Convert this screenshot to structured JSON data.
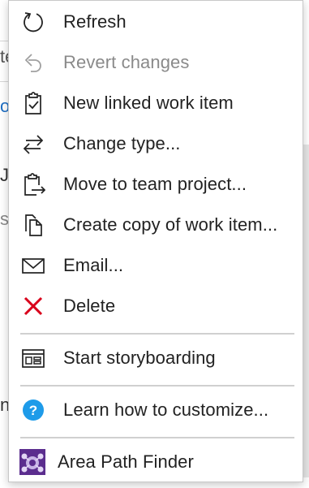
{
  "menu": {
    "items": [
      {
        "label": "Refresh",
        "icon": "refresh-icon"
      },
      {
        "label": "Revert changes",
        "icon": "undo-icon"
      },
      {
        "label": "New linked work item",
        "icon": "clipboard-check-icon"
      },
      {
        "label": "Change type...",
        "icon": "swap-arrows-icon"
      },
      {
        "label": "Move to team project...",
        "icon": "clipboard-arrow-icon"
      },
      {
        "label": "Create copy of work item...",
        "icon": "copy-icon"
      },
      {
        "label": "Email...",
        "icon": "envelope-icon"
      },
      {
        "label": "Delete",
        "icon": "delete-x-icon"
      },
      {
        "label": "Start storyboarding",
        "icon": "storyboard-icon"
      },
      {
        "label": "Learn how to customize...",
        "icon": "help-icon"
      },
      {
        "label": "Area Path Finder",
        "icon": "extension-logo-icon"
      }
    ]
  },
  "background": {
    "fragments": [
      "te",
      "o",
      "J",
      "s",
      "n"
    ]
  },
  "colors": {
    "delete_red": "#d9001b",
    "help_blue": "#1e9be9",
    "extension_purple": "#5b2d8e",
    "disabled_text": "#8a8a8a"
  }
}
